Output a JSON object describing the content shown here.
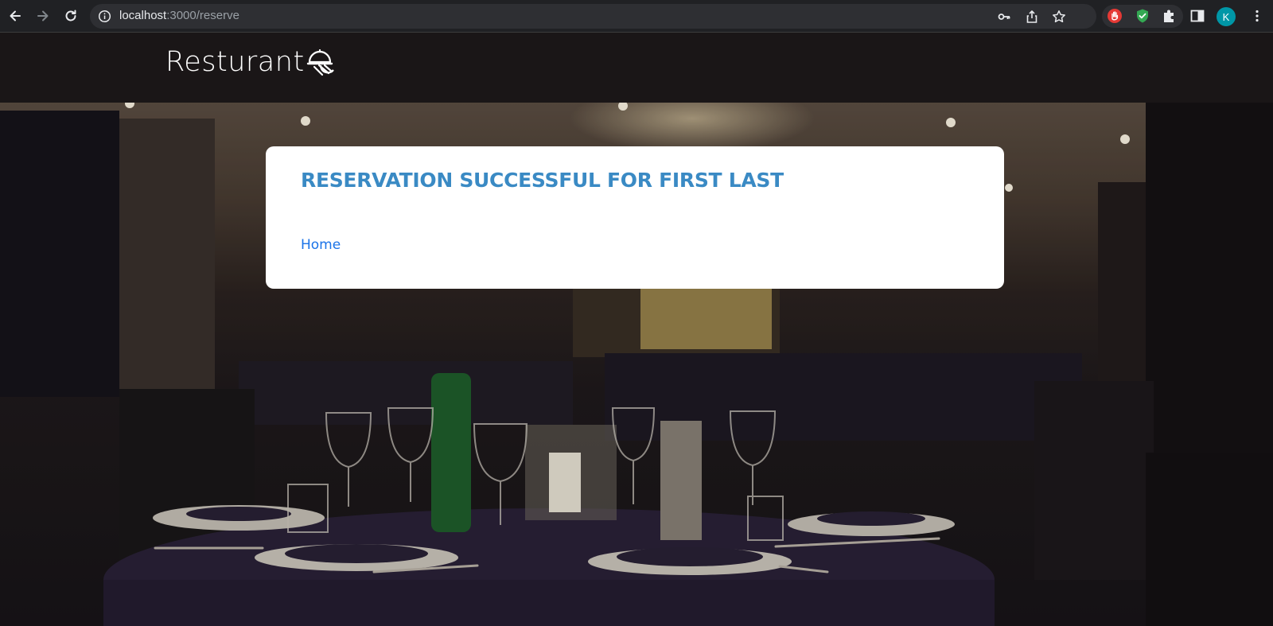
{
  "browser": {
    "url_host": "localhost",
    "url_path": ":3000/reserve",
    "profile_initial": "K",
    "icons": {
      "back": "back-arrow-icon",
      "forward": "forward-arrow-icon",
      "reload": "reload-icon",
      "site_info": "info-icon",
      "password": "key-icon",
      "share": "share-icon",
      "bookmark": "star-icon",
      "extension_1": "hand-stop-icon",
      "extension_2": "shield-check-icon",
      "extensions": "puzzle-icon",
      "side_panel": "side-panel-icon",
      "menu": "kebab-menu-icon"
    },
    "colors": {
      "toolbar": "#202124",
      "omnibox": "#2e2f33",
      "avatar": "#0097a7"
    }
  },
  "site": {
    "logo_text": "Resturant",
    "logo_icon": "food-cloche-icon"
  },
  "card": {
    "title": "RESERVATION SUCCESSFUL FOR FIRST LAST",
    "home_link": "Home"
  },
  "colors": {
    "title": "#3a8ac4",
    "link": "#1a73e8",
    "header_bg": "#1a1617"
  }
}
